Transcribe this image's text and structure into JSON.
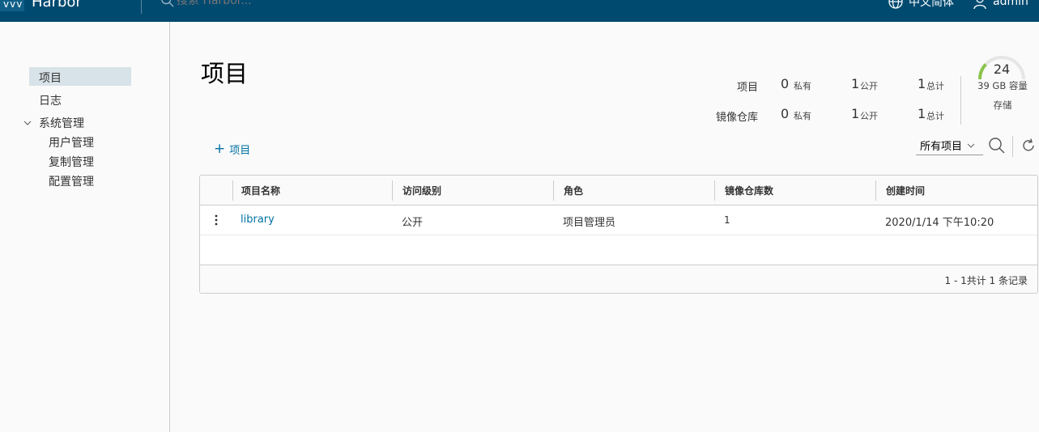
{
  "header": {
    "logo_text": "vvv",
    "brand": "Harbor",
    "search_placeholder": "搜索 Harbor...",
    "language": "中文简体",
    "user": "admin"
  },
  "sidebar": {
    "items": [
      {
        "label": "项目",
        "active": true
      },
      {
        "label": "日志"
      },
      {
        "label": "系统管理",
        "expanded": true
      }
    ],
    "admin_children": [
      "用户管理",
      "复制管理",
      "配置管理"
    ]
  },
  "main": {
    "title": "项目",
    "stats": {
      "projects_label": "项目",
      "repos_label": "镜像仓库",
      "private_label": "私有",
      "public_label": "公开",
      "total_label": "总计",
      "projects": {
        "private": "0",
        "public": "1",
        "total": "1"
      },
      "repos": {
        "private": "0",
        "public": "1",
        "total": "1"
      }
    },
    "storage": {
      "percent": "24",
      "capacity": "39 GB 容量",
      "label": "存储",
      "gauge_color": "#8bc34a"
    },
    "add_project_label": "项目",
    "filter_selected": "所有项目",
    "table": {
      "columns": [
        "项目名称",
        "访问级别",
        "角色",
        "镜像仓库数",
        "创建时间"
      ],
      "rows": [
        {
          "name": "library",
          "access": "公开",
          "role": "项目管理员",
          "repo_count": "1",
          "created": "2020/1/14 下午10:20"
        }
      ],
      "footer": "1 - 1共计 1 条记录"
    }
  },
  "colors": {
    "header_bg": "#004a70",
    "link": "#0072a3",
    "active_nav": "#d8e3e9"
  }
}
